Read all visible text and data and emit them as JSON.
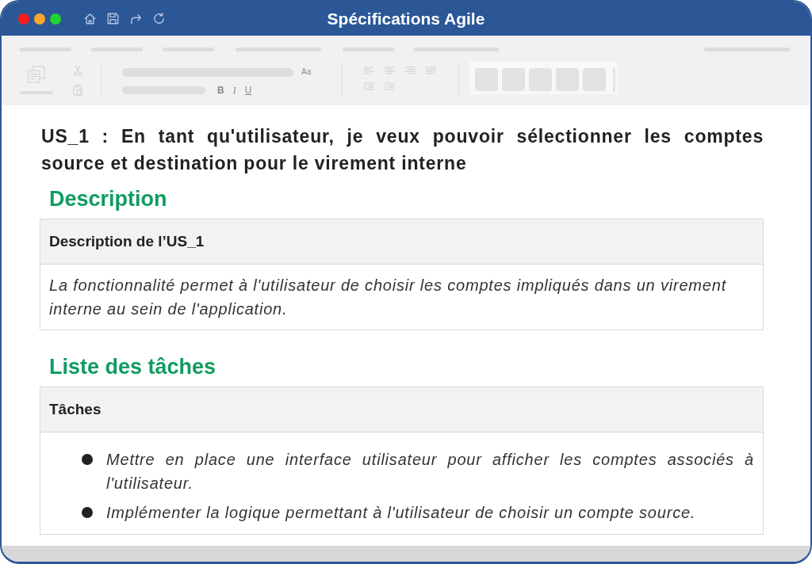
{
  "window": {
    "title": "Spécifications Agile"
  },
  "ribbon": {
    "format_controls": [
      {
        "label": "Aa",
        "kind": "case"
      },
      {
        "label": "B",
        "kind": "bold"
      },
      {
        "label": "I",
        "kind": "italic"
      },
      {
        "label": "U",
        "kind": "underline"
      }
    ]
  },
  "document": {
    "heading": "US_1 : En tant qu'utilisateur, je veux pouvoir sélectionner les comptes source et destination pour le virement interne",
    "sections": [
      {
        "title": "Description",
        "table": {
          "header": "Description de l’US_1",
          "kind": "paragraph",
          "text": "La fonctionnalité permet à l'utilisateur de choisir les comptes impliqués dans un virement interne au sein de l'application."
        }
      },
      {
        "title": "Liste des tâches",
        "table": {
          "header": "Tâches",
          "kind": "bullets",
          "items": [
            "Mettre en place une interface utilisateur pour afficher les comptes associés à l'utilisateur.",
            "Implémenter la logique permettant à l'utilisateur de choisir un compte source."
          ]
        }
      }
    ]
  }
}
